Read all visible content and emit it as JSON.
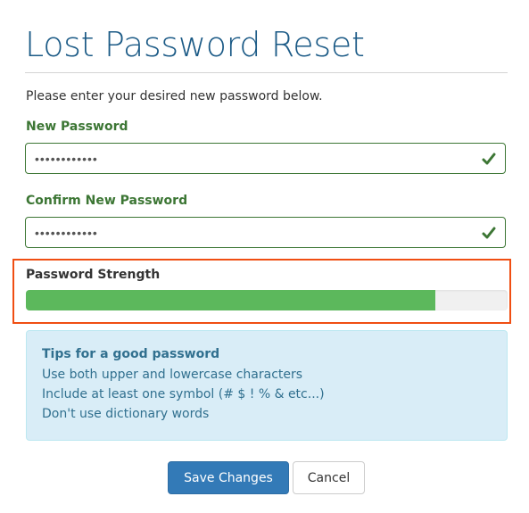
{
  "page": {
    "title": "Lost Password Reset",
    "intro": "Please enter your desired new password below."
  },
  "form": {
    "new_password": {
      "label": "New Password",
      "value": "••••••••••••",
      "valid": true,
      "status_icon": "check-icon"
    },
    "confirm_password": {
      "label": "Confirm New Password",
      "value": "••••••••••••",
      "valid": true,
      "status_icon": "check-icon"
    },
    "strength": {
      "label": "Password Strength",
      "value_fraction": 0.85,
      "color": "#5cb85c"
    }
  },
  "tips": {
    "title": "Tips for a good password",
    "items": [
      "Use both upper and lowercase characters",
      "Include at least one symbol (# $ ! % & etc...)",
      "Don't use dictionary words"
    ]
  },
  "actions": {
    "save_label": "Save Changes",
    "cancel_label": "Cancel"
  },
  "colors": {
    "title": "#1b5a86",
    "success": "#3c7634",
    "highlight": "#f04e12",
    "primary": "#337ab7",
    "info_bg": "#d9edf7",
    "info_text": "#31708f"
  }
}
